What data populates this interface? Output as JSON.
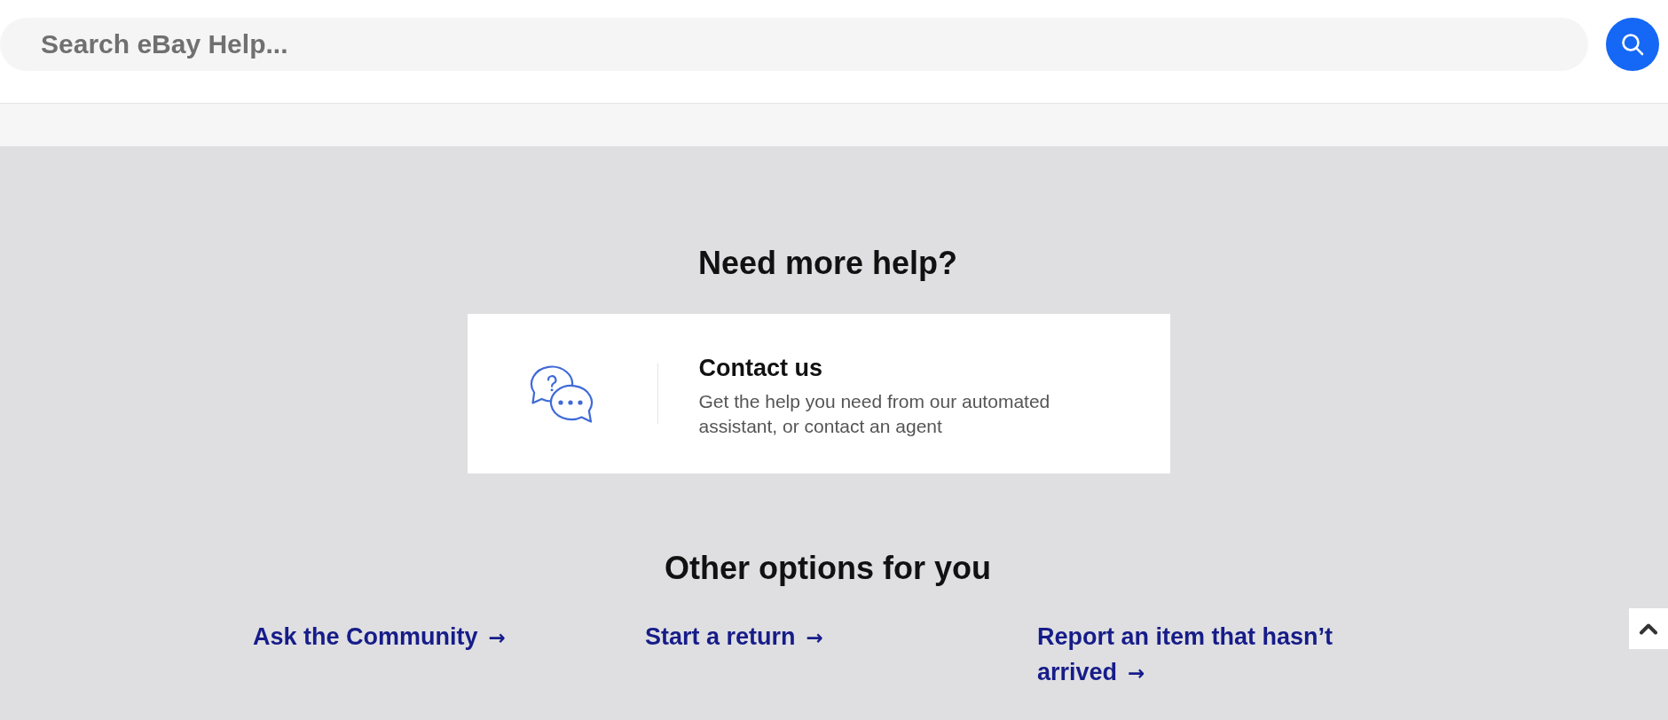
{
  "search": {
    "placeholder": "Search eBay Help..."
  },
  "need_more_help": {
    "title": "Need more help?",
    "contact_card": {
      "title": "Contact us",
      "description": "Get the help you need from our automated assistant, or contact an agent"
    }
  },
  "other_options": {
    "title": "Other options for you",
    "links": [
      {
        "label": "Ask the Community",
        "arrow": "→"
      },
      {
        "label": "Start a return",
        "arrow": "→"
      },
      {
        "label": "Report an item that hasn’t arrived",
        "arrow": "→"
      }
    ]
  }
}
